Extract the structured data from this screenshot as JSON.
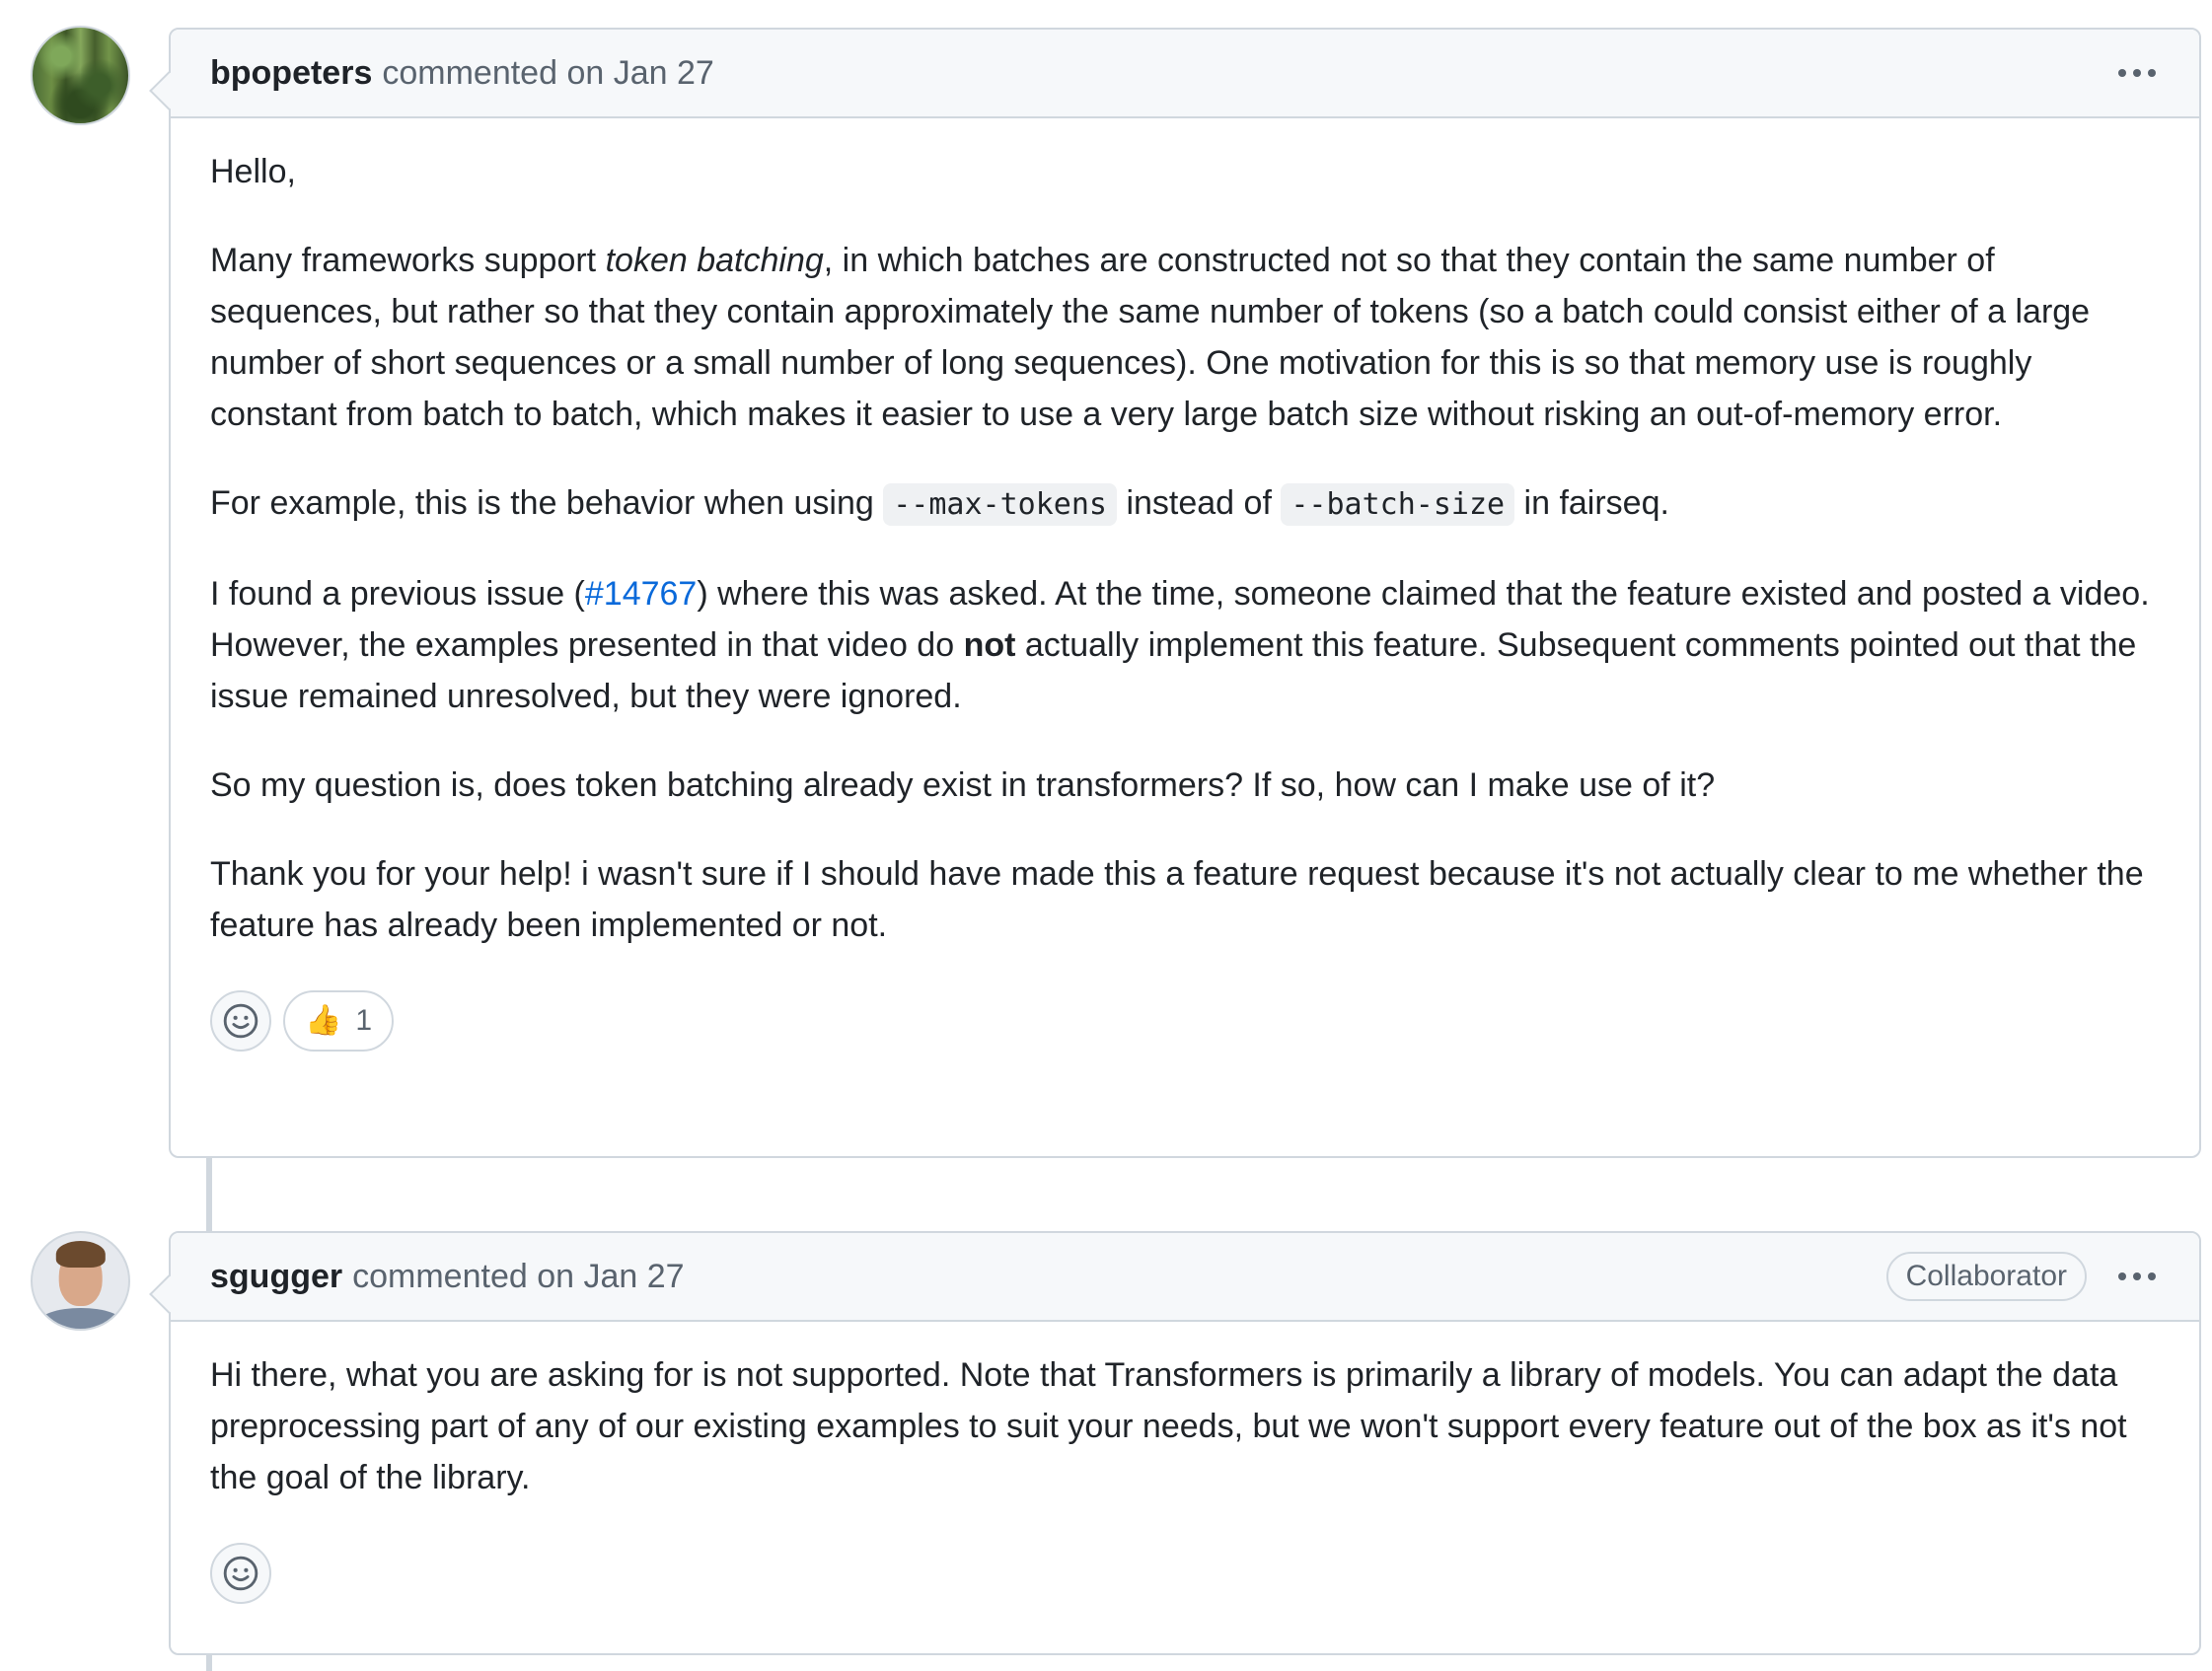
{
  "comments": [
    {
      "author": "bpopeters",
      "meta": "commented on Jan 27",
      "body": {
        "greeting": "Hello,",
        "p1": {
          "a": "Many frameworks support ",
          "em": "token batching",
          "b": ", in which batches are constructed not so that they contain the same number of sequences, but rather so that they contain approximately the same number of tokens (so a batch could consist either of a large number of short sequences or a small number of long sequences). One motivation for this is so that memory use is roughly constant from batch to batch, which makes it easier to use a very large batch size without risking an out-of-memory error."
        },
        "p2": {
          "a": "For example, this is the behavior when using ",
          "code1": "--max-tokens",
          "b": " instead of ",
          "code2": "--batch-size",
          "c": " in fairseq."
        },
        "p3": {
          "a": "I found a previous issue (",
          "link": "#14767",
          "b": ") where this was asked. At the time, someone claimed that the feature existed and posted a video. However, the examples presented in that video do ",
          "strong": "not",
          "c": " actually implement this feature. Subsequent comments pointed out that the issue remained unresolved, but they were ignored."
        },
        "p4": "So my question is, does token batching already exist in transformers? If so, how can I make use of it?",
        "p5": "Thank you for your help! i wasn't sure if I should have made this a feature request because it's not actually clear to me whether the feature has already been implemented or not."
      },
      "reactions": {
        "thumbs_up_icon": "👍",
        "thumbs_up_count": "1"
      }
    },
    {
      "author": "sgugger",
      "meta": "commented on Jan 27",
      "badge": "Collaborator",
      "body": "Hi there, what you are asking for is not supported. Note that Transformers is primarily a library of models. You can adapt the data preprocessing part of any of our existing examples to suit your needs, but we won't support every feature out of the box as it's not the goal of the library."
    }
  ],
  "colors": {
    "link": "#0969da",
    "border": "#d0d7de",
    "header_bg": "#f6f8fa",
    "muted": "#59636e"
  }
}
